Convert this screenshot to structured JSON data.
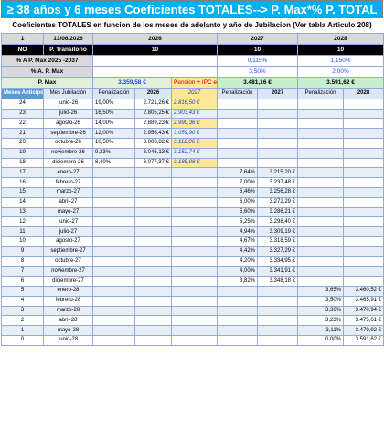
{
  "title": "≥ 38 años y 6 meses Coeficientes TOTALES--> P. Max*% P. TOTAL",
  "subtitle": "Coeficientes TOTALES en funcion de los meses de adelanto y año de Jubilacion (Ver tabla Articulo 208)",
  "row1": {
    "n": "1",
    "date": "13/06/2026",
    "y1": "2026",
    "y2": "2027",
    "y3": "2028"
  },
  "row2": {
    "no": "NO",
    "label": "P. Transitorio",
    "v1": "10",
    "v2": "10",
    "v3": "10"
  },
  "row3": {
    "label": "% A P. Max 2025 -2037",
    "v2": "0,115%",
    "v3": "1,150%"
  },
  "row4": {
    "label": "% A. P. Max",
    "v2": "3,50%",
    "v3": "2,00%"
  },
  "row5": {
    "label": "P. Max",
    "v1": "3.359,58 €",
    "pension_label": "Pension + IPC en",
    "v2": "3.481,16 €",
    "v3": "3.591,62 €"
  },
  "colheaders": {
    "meses": "Meses Anticipo",
    "jub": "Mes Jubilación",
    "pen1": "Penalización",
    "y2026": "2026",
    "y2027i": "2027",
    "pen2": "Penalización",
    "y2027": "2027",
    "pen3": "Penalización",
    "y2028": "2028"
  },
  "rows": [
    {
      "m": "24",
      "mes": "junio-26",
      "p1": "19,00%",
      "v1": "2.721,26 €",
      "o": "2.816,50 €",
      "p2": "",
      "v2": "",
      "p3": "",
      "v3": ""
    },
    {
      "m": "23",
      "mes": "julio-26",
      "p1": "16,50%",
      "v1": "2.805,25 €",
      "o": "2.903,43 €",
      "p2": "",
      "v2": "",
      "p3": "",
      "v3": ""
    },
    {
      "m": "22",
      "mes": "agosto-26",
      "p1": "14,00%",
      "v1": "2.889,23 €",
      "o": "2.990,36 €",
      "p2": "",
      "v2": "",
      "p3": "",
      "v3": ""
    },
    {
      "m": "21",
      "mes": "septiembre-26",
      "p1": "12,00%",
      "v1": "2.956,43 €",
      "o": "3.059,90 €",
      "p2": "",
      "v2": "",
      "p3": "",
      "v3": ""
    },
    {
      "m": "20",
      "mes": "octubre-26",
      "p1": "10,50%",
      "v1": "3.006,82 €",
      "o": "3.112,06 €",
      "p2": "",
      "v2": "",
      "p3": "",
      "v3": ""
    },
    {
      "m": "19",
      "mes": "noviembre-26",
      "p1": "9,33%",
      "v1": "3.046,13 €",
      "o": "3.152,74 €",
      "p2": "",
      "v2": "",
      "p3": "",
      "v3": ""
    },
    {
      "m": "18",
      "mes": "diciembre-26",
      "p1": "8,40%",
      "v1": "3.077,37 €",
      "o": "3.185,08 €",
      "p2": "",
      "v2": "",
      "p3": "",
      "v3": ""
    },
    {
      "m": "17",
      "mes": "enero-27",
      "p1": "",
      "v1": "",
      "o": "",
      "p2": "7,64%",
      "v2": "3.215,20 €",
      "p3": "",
      "v3": ""
    },
    {
      "m": "16",
      "mes": "febrero-27",
      "p1": "",
      "v1": "",
      "o": "",
      "p2": "7,00%",
      "v2": "3.237,48 €",
      "p3": "",
      "v3": ""
    },
    {
      "m": "15",
      "mes": "marzo-27",
      "p1": "",
      "v1": "",
      "o": "",
      "p2": "6,46%",
      "v2": "3.256,28 €",
      "p3": "",
      "v3": ""
    },
    {
      "m": "14",
      "mes": "abril-27",
      "p1": "",
      "v1": "",
      "o": "",
      "p2": "6,00%",
      "v2": "3.272,29 €",
      "p3": "",
      "v3": ""
    },
    {
      "m": "13",
      "mes": "mayo-27",
      "p1": "",
      "v1": "",
      "o": "",
      "p2": "5,60%",
      "v2": "3.286,21 €",
      "p3": "",
      "v3": ""
    },
    {
      "m": "12",
      "mes": "junio-27",
      "p1": "",
      "v1": "",
      "o": "",
      "p2": "5,25%",
      "v2": "3.298,40 €",
      "p3": "",
      "v3": ""
    },
    {
      "m": "11",
      "mes": "julio-27",
      "p1": "",
      "v1": "",
      "o": "",
      "p2": "4,94%",
      "v2": "3.309,19 €",
      "p3": "",
      "v3": ""
    },
    {
      "m": "10",
      "mes": "agosto-27",
      "p1": "",
      "v1": "",
      "o": "",
      "p2": "4,67%",
      "v2": "3.318,59 €",
      "p3": "",
      "v3": ""
    },
    {
      "m": "9",
      "mes": "septiembre-27",
      "p1": "",
      "v1": "",
      "o": "",
      "p2": "4,42%",
      "v2": "3.327,29 €",
      "p3": "",
      "v3": ""
    },
    {
      "m": "8",
      "mes": "octubre-27",
      "p1": "",
      "v1": "",
      "o": "",
      "p2": "4,20%",
      "v2": "3.334,95 €",
      "p3": "",
      "v3": ""
    },
    {
      "m": "7",
      "mes": "noviembre-27",
      "p1": "",
      "v1": "",
      "o": "",
      "p2": "4,00%",
      "v2": "3.341,91 €",
      "p3": "",
      "v3": ""
    },
    {
      "m": "6",
      "mes": "diciembre-27",
      "p1": "",
      "v1": "",
      "o": "",
      "p2": "3,82%",
      "v2": "3.348,18 €",
      "p3": "",
      "v3": ""
    },
    {
      "m": "5",
      "mes": "enero-28",
      "p1": "",
      "v1": "",
      "o": "",
      "p2": "",
      "v2": "",
      "p3": "3,65%",
      "v3": "3.460,52 €"
    },
    {
      "m": "4",
      "mes": "febrero-28",
      "p1": "",
      "v1": "",
      "o": "",
      "p2": "",
      "v2": "",
      "p3": "3,50%",
      "v3": "3.465,91 €"
    },
    {
      "m": "3",
      "mes": "marzo-28",
      "p1": "",
      "v1": "",
      "o": "",
      "p2": "",
      "v2": "",
      "p3": "3,36%",
      "v3": "3.470,94 €"
    },
    {
      "m": "2",
      "mes": "abril-28",
      "p1": "",
      "v1": "",
      "o": "",
      "p2": "",
      "v2": "",
      "p3": "3,23%",
      "v3": "3.475,61 €"
    },
    {
      "m": "1",
      "mes": "mayo-28",
      "p1": "",
      "v1": "",
      "o": "",
      "p2": "",
      "v2": "",
      "p3": "3,11%",
      "v3": "3.479,92 €"
    },
    {
      "m": "0",
      "mes": "junio-28",
      "p1": "",
      "v1": "",
      "o": "",
      "p2": "",
      "v2": "",
      "p3": "0,00%",
      "v3": "3.591,62 €"
    }
  ]
}
